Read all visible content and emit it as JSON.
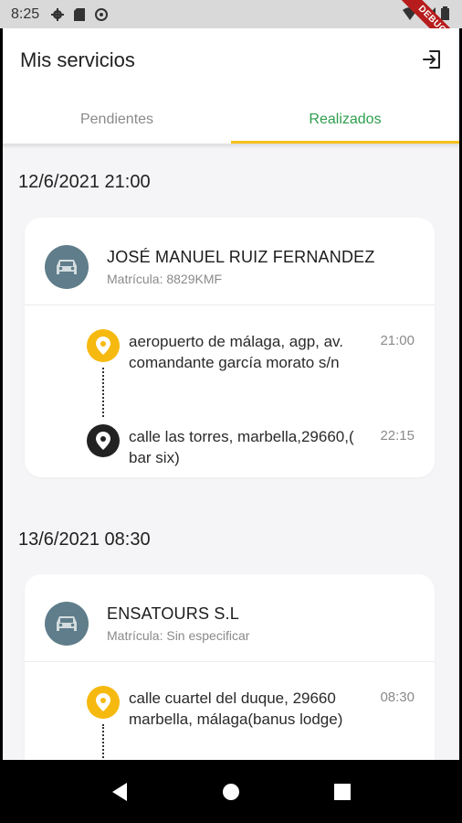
{
  "status_bar": {
    "time": "8:25",
    "ribbon": "DEBUG",
    "icons": [
      "gear-icon",
      "sd-card-icon",
      "sync-icon",
      "wifi-icon",
      "signal-icon",
      "battery-icon"
    ]
  },
  "app_bar": {
    "title": "Mis servicios",
    "action_icon": "logout-icon"
  },
  "tabs": [
    {
      "label": "Pendientes",
      "active": false
    },
    {
      "label": "Realizados",
      "active": true
    }
  ],
  "accent_colors": {
    "active_tab_text": "#2e9e4f",
    "tab_indicator": "#f6c21a",
    "origin_marker": "#f6b90f",
    "destination_marker": "#222222",
    "avatar_bg": "#5f7d8a"
  },
  "services": [
    {
      "date": "12/6/2021 21:00",
      "driver": "JOSÉ MANUEL RUIZ FERNANDEZ",
      "plate": "Matrícula: 8829KMF",
      "origin": {
        "address": "aeropuerto de málaga, agp, av. comandante garcía morato s/n",
        "time": "21:00"
      },
      "destination": {
        "address": "calle las torres, marbella,29660,( bar six)",
        "time": "22:15"
      }
    },
    {
      "date": "13/6/2021 08:30",
      "driver": "ENSATOURS S.L",
      "plate": "Matrícula: Sin especificar",
      "origin": {
        "address": "calle cuartel del duque, 29660 marbella, málaga(banus lodge)",
        "time": "08:30"
      }
    }
  ],
  "nav_bar": {
    "icons": [
      "back-icon",
      "home-icon",
      "recents-icon"
    ]
  }
}
